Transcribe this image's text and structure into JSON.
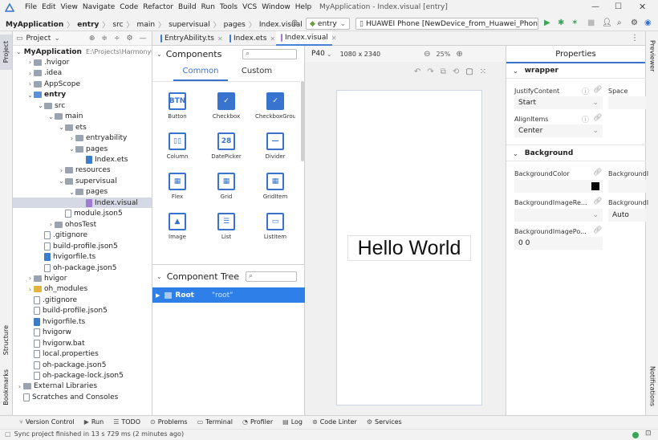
{
  "titlebar": {
    "menu": [
      "File",
      "Edit",
      "View",
      "Navigate",
      "Code",
      "Refactor",
      "Build",
      "Run",
      "Tools",
      "VCS",
      "Window",
      "Help"
    ],
    "title": "MyApplication - Index.visual [entry]"
  },
  "breadcrumb": {
    "items": [
      "MyApplication",
      "entry",
      "src",
      "main",
      "supervisual",
      "pages",
      "Index.visual"
    ]
  },
  "runconfig": {
    "module": "entry",
    "device": "HUAWEI Phone [NewDevice_from_Huawei_Phone]"
  },
  "project": {
    "header": "Project",
    "root_name": "MyApplication",
    "root_path": "E:\\Projects\\HarmonyOS",
    "tree": [
      {
        "label": "MyApplication",
        "indent": 0,
        "chev": "v",
        "icon": "folder",
        "bold": true
      },
      {
        "label": ".hvigor",
        "indent": 1,
        "chev": ">",
        "icon": "folder"
      },
      {
        "label": ".idea",
        "indent": 1,
        "chev": ">",
        "icon": "folder"
      },
      {
        "label": "AppScope",
        "indent": 1,
        "chev": ">",
        "icon": "folder"
      },
      {
        "label": "entry",
        "indent": 1,
        "chev": "v",
        "icon": "folder-b",
        "bold": true
      },
      {
        "label": "src",
        "indent": 2,
        "chev": "v",
        "icon": "folder"
      },
      {
        "label": "main",
        "indent": 3,
        "chev": "v",
        "icon": "folder"
      },
      {
        "label": "ets",
        "indent": 4,
        "chev": "v",
        "icon": "folder"
      },
      {
        "label": "entryability",
        "indent": 5,
        "chev": ">",
        "icon": "folder"
      },
      {
        "label": "pages",
        "indent": 5,
        "chev": "v",
        "icon": "folder"
      },
      {
        "label": "Index.ets",
        "indent": 6,
        "chev": "",
        "icon": "file-ts"
      },
      {
        "label": "resources",
        "indent": 4,
        "chev": ">",
        "icon": "folder"
      },
      {
        "label": "supervisual",
        "indent": 4,
        "chev": "v",
        "icon": "folder"
      },
      {
        "label": "pages",
        "indent": 5,
        "chev": "v",
        "icon": "folder"
      },
      {
        "label": "Index.visual",
        "indent": 6,
        "chev": "",
        "icon": "file-v",
        "selected": true
      },
      {
        "label": "module.json5",
        "indent": 4,
        "chev": "",
        "icon": "file"
      },
      {
        "label": "ohosTest",
        "indent": 3,
        "chev": ">",
        "icon": "folder"
      },
      {
        "label": ".gitignore",
        "indent": 2,
        "chev": "",
        "icon": "file"
      },
      {
        "label": "build-profile.json5",
        "indent": 2,
        "chev": "",
        "icon": "file"
      },
      {
        "label": "hvigorfile.ts",
        "indent": 2,
        "chev": "",
        "icon": "file-ts"
      },
      {
        "label": "oh-package.json5",
        "indent": 2,
        "chev": "",
        "icon": "file"
      },
      {
        "label": "hvigor",
        "indent": 1,
        "chev": ">",
        "icon": "folder"
      },
      {
        "label": "oh_modules",
        "indent": 1,
        "chev": ">",
        "icon": "folder-y"
      },
      {
        "label": ".gitignore",
        "indent": 1,
        "chev": "",
        "icon": "file"
      },
      {
        "label": "build-profile.json5",
        "indent": 1,
        "chev": "",
        "icon": "file"
      },
      {
        "label": "hvigorfile.ts",
        "indent": 1,
        "chev": "",
        "icon": "file-ts"
      },
      {
        "label": "hvigorw",
        "indent": 1,
        "chev": "",
        "icon": "file"
      },
      {
        "label": "hvigorw.bat",
        "indent": 1,
        "chev": "",
        "icon": "file"
      },
      {
        "label": "local.properties",
        "indent": 1,
        "chev": "",
        "icon": "file"
      },
      {
        "label": "oh-package.json5",
        "indent": 1,
        "chev": "",
        "icon": "file"
      },
      {
        "label": "oh-package-lock.json5",
        "indent": 1,
        "chev": "",
        "icon": "file"
      },
      {
        "label": "External Libraries",
        "indent": 0,
        "chev": ">",
        "icon": "lib"
      },
      {
        "label": "Scratches and Consoles",
        "indent": 0,
        "chev": "",
        "icon": "scratch"
      }
    ]
  },
  "tabs": [
    {
      "label": "EntryAbility.ts",
      "active": false
    },
    {
      "label": "Index.ets",
      "active": false
    },
    {
      "label": "Index.visual",
      "active": true
    }
  ],
  "components": {
    "title": "Components",
    "tab_common": "Common",
    "tab_custom": "Custom",
    "items": [
      {
        "label": "Button",
        "glyph": "BTN"
      },
      {
        "label": "Checkbox",
        "glyph": "✓"
      },
      {
        "label": "CheckboxGroup",
        "glyph": "✓"
      },
      {
        "label": "Column",
        "glyph": "▯▯"
      },
      {
        "label": "DatePicker",
        "glyph": "28"
      },
      {
        "label": "Divider",
        "glyph": "—"
      },
      {
        "label": "Flex",
        "glyph": "▦"
      },
      {
        "label": "Grid",
        "glyph": "▦"
      },
      {
        "label": "GridItem",
        "glyph": "▦"
      },
      {
        "label": "Image",
        "glyph": "▲"
      },
      {
        "label": "List",
        "glyph": "☰"
      },
      {
        "label": "ListItem",
        "glyph": "▭"
      }
    ]
  },
  "component_tree": {
    "title": "Component Tree",
    "root": "Root",
    "root_id": "\"root\""
  },
  "canvas": {
    "device": "P40",
    "resolution": "1080 x 2340",
    "zoom": "25%",
    "preview_text": "Hello World"
  },
  "properties": {
    "title": "Properties",
    "wrapper_section": "wrapper",
    "justify_label": "JustifyContent",
    "justify_value": "Start",
    "space_label": "Space",
    "align_label": "AlignItems",
    "align_value": "Center",
    "background_section": "Background",
    "bgcolor_label": "BackgroundColor",
    "bgimage_label": "BackgroundI",
    "bgimage_repeat_label": "BackgroundImageRe...",
    "bgimage_size_label": "BackgroundI",
    "bgimage_size_value": "Auto",
    "bgimage_pos_label": "BackgroundImagePo...",
    "bgimage_pos_value": "0 0"
  },
  "side_tabs": {
    "project": "Project",
    "structure": "Structure",
    "bookmarks": "Bookmarks",
    "previewer": "Previewer",
    "notifications": "Notifications"
  },
  "bottom_tools": [
    "Version Control",
    "Run",
    "TODO",
    "Problems",
    "Terminal",
    "Profiler",
    "Log",
    "Code Linter",
    "Services"
  ],
  "status": {
    "text": "Sync project finished in 13 s 729 ms (2 minutes ago)"
  },
  "colors": {
    "accent": "#3873cf",
    "selection": "#2f7fe8"
  }
}
